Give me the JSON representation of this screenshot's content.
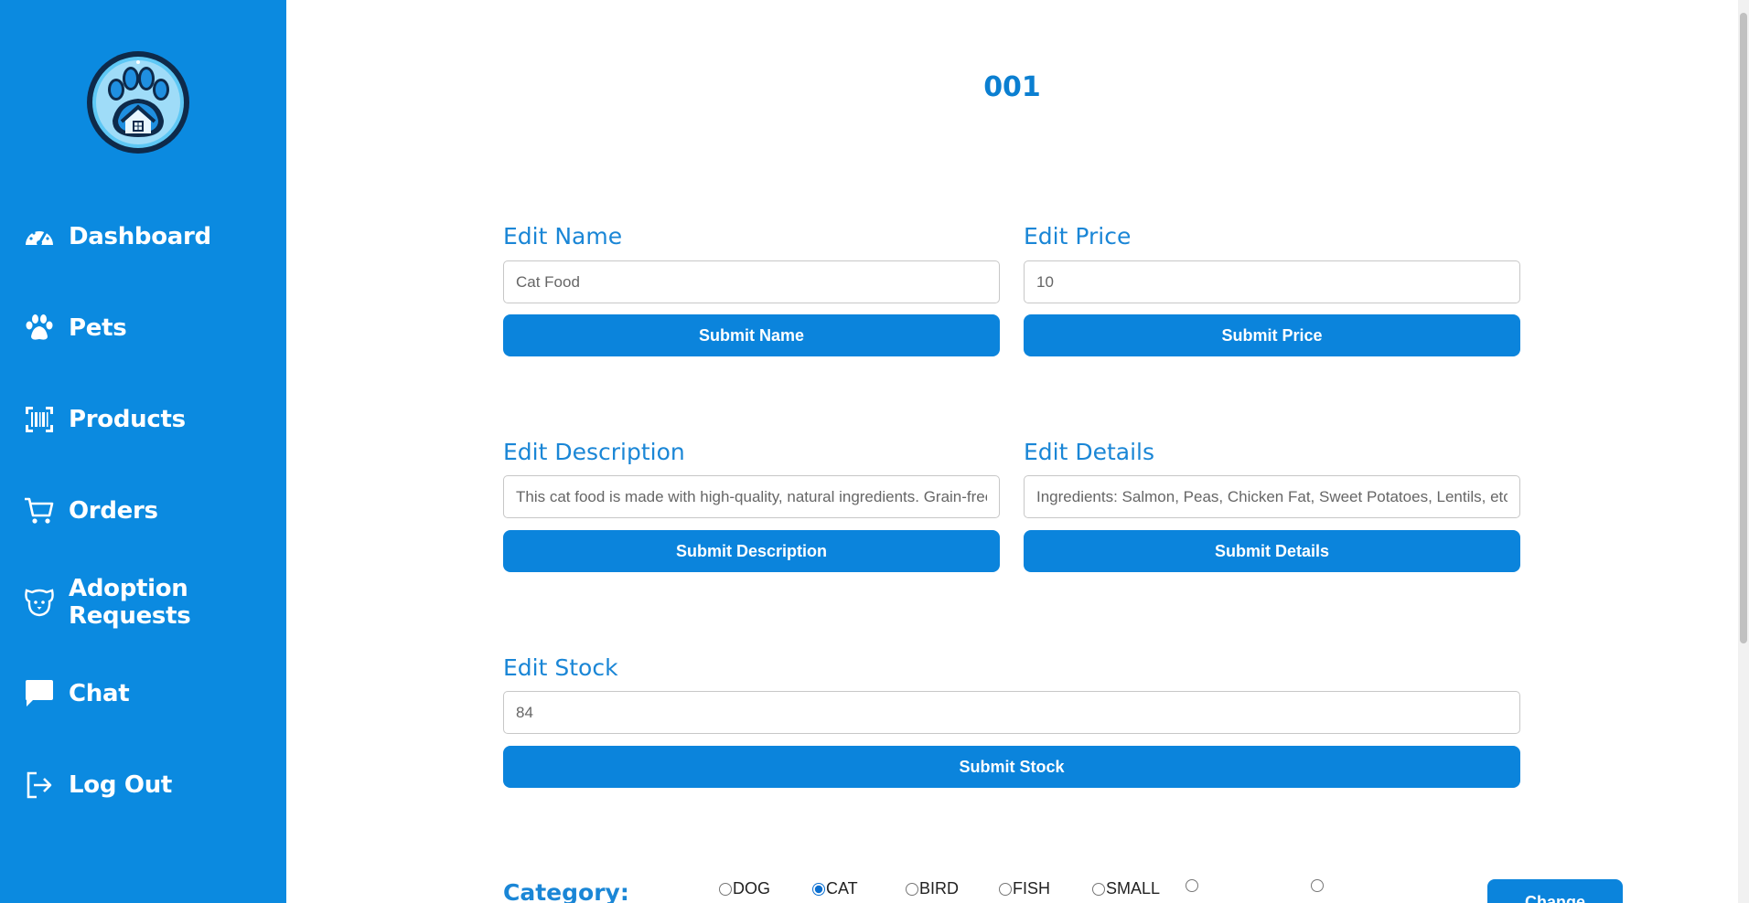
{
  "sidebar": {
    "logo_icon": "paw-house-logo",
    "items": [
      {
        "label": "Dashboard",
        "icon": "gauge-icon"
      },
      {
        "label": "Pets",
        "icon": "paw-icon"
      },
      {
        "label": "Products",
        "icon": "barcode-icon"
      },
      {
        "label": "Orders",
        "icon": "cart-icon"
      },
      {
        "label": "Adoption Requests",
        "icon": "dog-face-icon"
      },
      {
        "label": "Chat",
        "icon": "chat-bubble-icon"
      },
      {
        "label": "Log Out",
        "icon": "logout-icon"
      }
    ]
  },
  "page": {
    "title": "001"
  },
  "form": {
    "name": {
      "label": "Edit Name",
      "value": "Cat Food",
      "button": "Submit Name"
    },
    "price": {
      "label": "Edit Price",
      "value": "10",
      "button": "Submit Price"
    },
    "description": {
      "label": "Edit Description",
      "value": "This cat food is made with high-quality, natural ingredients. Grain-free",
      "button": "Submit Description"
    },
    "details": {
      "label": "Edit Details",
      "value": "Ingredients: Salmon, Peas, Chicken Fat, Sweet Potatoes, Lentils, etc.",
      "button": "Submit Details"
    },
    "stock": {
      "label": "Edit Stock",
      "value": "84",
      "button": "Submit Stock"
    }
  },
  "category": {
    "label": "Category:",
    "options": [
      {
        "label": "DOG",
        "checked": false
      },
      {
        "label": "CAT",
        "checked": true
      },
      {
        "label": "BIRD",
        "checked": false
      },
      {
        "label": "FISH",
        "checked": false
      },
      {
        "label": "SMALL",
        "checked": false
      },
      {
        "label": "",
        "checked": false
      },
      {
        "label": "",
        "checked": false
      }
    ],
    "button": "Change"
  },
  "colors": {
    "sidebar_bg": "#0b8ae0",
    "accent": "#0b84dc",
    "label_text": "#1a86d6"
  }
}
